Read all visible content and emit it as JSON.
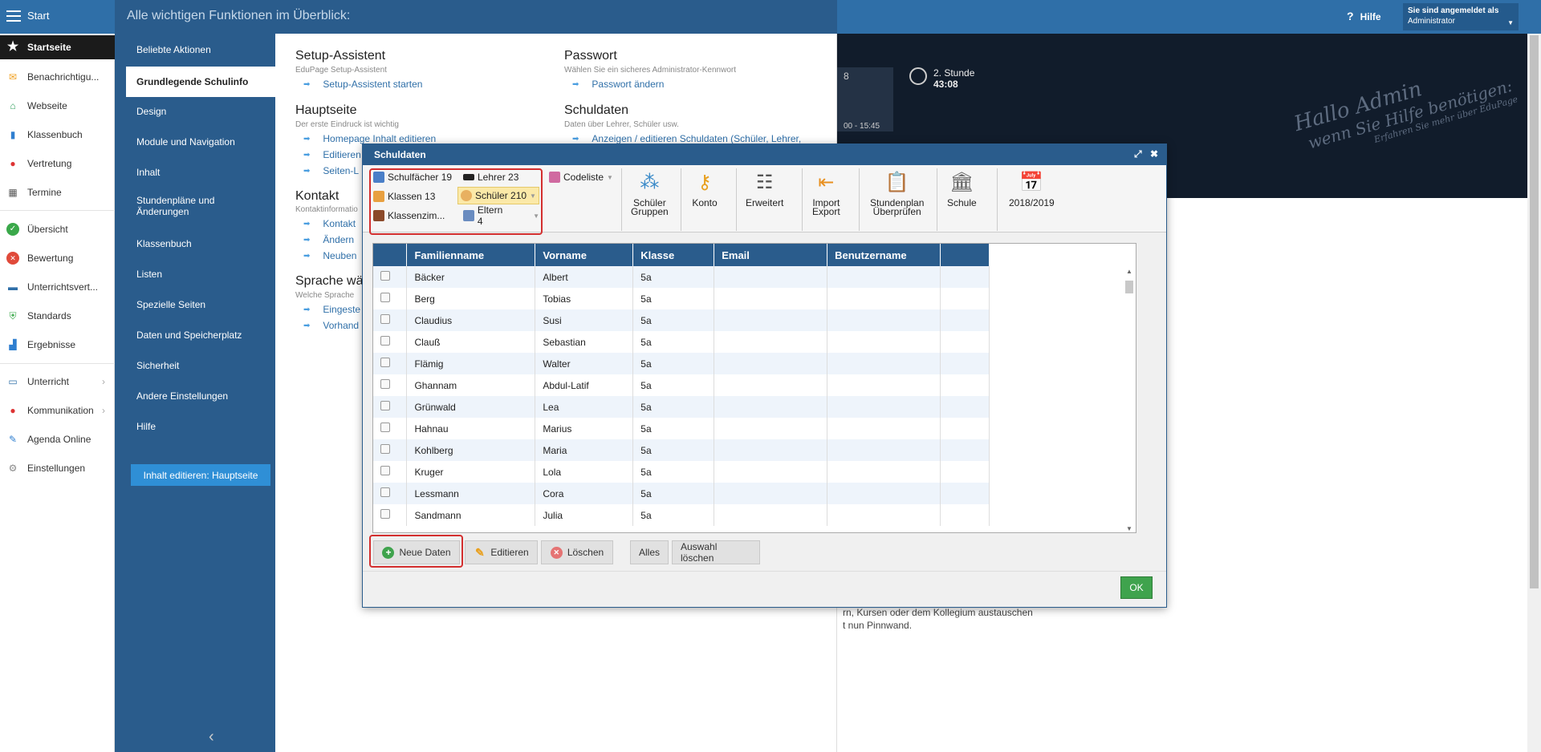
{
  "topbar": {
    "start_label": "Start",
    "header_title": "Alle wichtigen Funktionen im Überblick:",
    "help_label": "Hilfe",
    "account_line1": "Sie sind angemeldet als",
    "account_line2": "Administrator"
  },
  "sidebar": {
    "items": [
      {
        "label": "Startseite",
        "icon": "star-icon"
      },
      {
        "label": "Benachrichtigu...",
        "icon": "envelope-icon"
      },
      {
        "label": "Webseite",
        "icon": "home-icon"
      },
      {
        "label": "Klassenbuch",
        "icon": "book-icon"
      },
      {
        "label": "Vertretung",
        "icon": "person-icon"
      },
      {
        "label": "Termine",
        "icon": "calendar-icon"
      },
      {
        "label": "Übersicht",
        "icon": "check-icon"
      },
      {
        "label": "Bewertung",
        "icon": "grade-icon"
      },
      {
        "label": "Unterrichtsvert...",
        "icon": "briefcase-icon"
      },
      {
        "label": "Standards",
        "icon": "shield-icon"
      },
      {
        "label": "Ergebnisse",
        "icon": "bar-chart-icon"
      },
      {
        "label": "Unterricht",
        "icon": "class-icon"
      },
      {
        "label": "Kommunikation",
        "icon": "chat-icon"
      },
      {
        "label": "Agenda Online",
        "icon": "pen-icon"
      },
      {
        "label": "Einstellungen",
        "icon": "gear-icon"
      }
    ]
  },
  "menu": {
    "items": [
      "Beliebte Aktionen",
      "Grundlegende Schulinfo",
      "Design",
      "Module und Navigation",
      "Inhalt",
      "Stundenpläne und Änderungen",
      "Klassenbuch",
      "Listen",
      "Spezielle Seiten",
      "Daten und Speicherplatz",
      "Sicherheit",
      "Andere Einstellungen",
      "Hilfe"
    ],
    "edit_button": "Inhalt editieren: Hauptseite"
  },
  "content": {
    "setup_title": "Setup-Assistent",
    "setup_sub": "EduPage Setup-Assistent",
    "setup_link": "Setup-Assistent starten",
    "pw_title": "Passwort",
    "pw_sub": "Wählen Sie ein sicheres Administrator-Kennwort",
    "pw_link": "Passwort ändern",
    "main_title": "Hauptseite",
    "main_sub": "Der erste Eindruck ist wichtig",
    "main_link1": "Homepage Inhalt editieren",
    "main_link2": "Editieren",
    "main_link3": "Seiten-L",
    "sd_title": "Schuldaten",
    "sd_sub": "Daten über Lehrer, Schüler usw.",
    "sd_link": "Anzeigen / editieren Schuldaten (Schüler, Lehrer,",
    "contact_title": "Kontakt",
    "contact_sub": "Kontaktinformatio",
    "contact_link1": "Kontakt",
    "contact_link2": "Ändern",
    "contact_link3": "Neuben",
    "lang_title": "Sprache wä",
    "lang_sub": "Welche Sprache",
    "lang_link1": "Eingeste",
    "lang_link2": "Vorhand"
  },
  "dash": {
    "tile_num": "8",
    "tile_time": "00 - 15:45",
    "period": "2. Stunde",
    "countdown": "43:08",
    "hello1": "Hallo Admin",
    "hello2": "wenn Sie Hilfe benötigen:",
    "hello3": "Erfahren Sie mehr über EduPage",
    "below1": "rn, Kursen oder dem Kollegium austauschen",
    "below2": "t nun Pinnwand."
  },
  "dialog": {
    "title": "Schuldaten",
    "toolbar": {
      "subjects": "Schulfächer 19",
      "teachers": "Lehrer 23",
      "codelist": "Codeliste",
      "classes": "Klassen 13",
      "students": "Schüler 210",
      "rooms": "Klassenzim...",
      "parents": "Eltern 4",
      "groups_line1": "Schüler",
      "groups_line2": "Gruppen",
      "account": "Konto",
      "advanced": "Erweitert",
      "import_line1": "Import",
      "import_line2": "Export",
      "timetable_line1": "Stundenplan",
      "timetable_line2": "Überprüfen",
      "school": "Schule",
      "year": "2018/2019"
    },
    "columns": [
      "Familienname",
      "Vorname",
      "Klasse",
      "Email",
      "Benutzername"
    ],
    "rows": [
      [
        "Bäcker",
        "Albert",
        "5a",
        "",
        ""
      ],
      [
        "Berg",
        "Tobias",
        "5a",
        "",
        ""
      ],
      [
        "Claudius",
        "Susi",
        "5a",
        "",
        ""
      ],
      [
        "Clauß",
        "Sebastian",
        "5a",
        "",
        ""
      ],
      [
        "Flämig",
        "Walter",
        "5a",
        "",
        ""
      ],
      [
        "Ghannam",
        "Abdul-Latif",
        "5a",
        "",
        ""
      ],
      [
        "Grünwald",
        "Lea",
        "5a",
        "",
        ""
      ],
      [
        "Hahnau",
        "Marius",
        "5a",
        "",
        ""
      ],
      [
        "Kohlberg",
        "Maria",
        "5a",
        "",
        ""
      ],
      [
        "Kruger",
        "Lola",
        "5a",
        "",
        ""
      ],
      [
        "Lessmann",
        "Cora",
        "5a",
        "",
        ""
      ],
      [
        "Sandmann",
        "Julia",
        "5a",
        "",
        ""
      ]
    ],
    "buttons": {
      "new": "Neue Daten",
      "edit": "Editieren",
      "delete": "Löschen",
      "all": "Alles",
      "clear": "Auswahl löschen",
      "ok": "OK"
    }
  }
}
